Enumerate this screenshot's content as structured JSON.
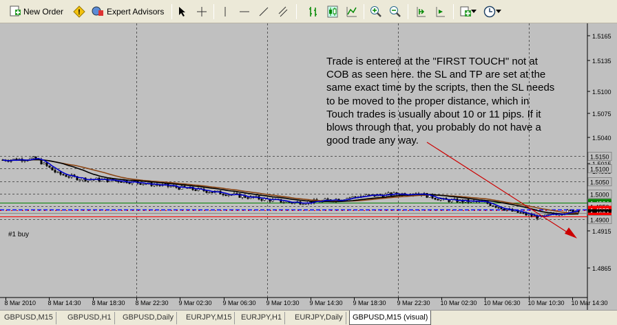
{
  "toolbar": {
    "new_order": "New Order",
    "expert_advisors": "Expert Advisors"
  },
  "chart": {
    "annotation": [
      "Trade is entered at the \"FIRST TOUCH\" not at",
      "COB as seen here.  the SL and TP are set at the",
      "same exact time by the scripts, then the SL needs",
      "to be moved to the proper distance, which in",
      "Touch trades is usually about 10 or 11 pips.  If it",
      "blows through that, you probably do not have a",
      "good trade any way."
    ],
    "order_label": "#1 buy",
    "colors": {
      "background": "#c0c0c0",
      "candle": "#000000",
      "ma_fast": "#0000cc",
      "ma_mid": "#000000",
      "ma_slow": "#8b4513",
      "tp_line": "#008000",
      "sl_line": "#ff0000",
      "entry_line": "#0000ff",
      "arrow": "#cc0000"
    },
    "price_scale": [
      "1.5165",
      "1.5135",
      "1.5100",
      "1.5075",
      "1.5040",
      "1.5015",
      "1.4985",
      "1.4950",
      "1.4915",
      "1.4865"
    ],
    "price_tags": [
      {
        "label": "1.5150",
        "price": 1.515,
        "kind": "grid"
      },
      {
        "label": "1.5100",
        "price": 1.51,
        "kind": "grid"
      },
      {
        "label": "1.5050",
        "price": 1.505,
        "kind": "grid"
      },
      {
        "label": "1.5000",
        "price": 1.5,
        "kind": "grid"
      },
      {
        "label": "1.4964",
        "price": 1.4964,
        "kind": "tp"
      },
      {
        "label": "1.4950",
        "price": 1.495,
        "kind": "grid"
      },
      {
        "label": "1.4938",
        "price": 1.4938,
        "kind": "entry"
      },
      {
        "label": "1.4924",
        "price": 1.4924,
        "kind": "bid"
      },
      {
        "label": "1.4910",
        "price": 1.491,
        "kind": "sl"
      },
      {
        "label": "1.4900",
        "price": 1.49,
        "kind": "grid"
      }
    ],
    "time_labels": [
      "8 Mar 2010",
      "8 Mar 14:30",
      "8 Mar 18:30",
      "8 Mar 22:30",
      "9 Mar 02:30",
      "9 Mar 06:30",
      "9 Mar 10:30",
      "9 Mar 14:30",
      "9 Mar 18:30",
      "9 Mar 22:30",
      "10 Mar 02:30",
      "10 Mar 06:30",
      "10 Mar 10:30",
      "10 Mar 14:30"
    ]
  },
  "tabs": [
    "GBPUSD,M15",
    "GBPUSD,H1",
    "GBPUSD,Daily",
    "EURJPY,M15",
    "EURJPY,H1",
    "EURJPY,Daily",
    "GBPUSD,M15 (visual)"
  ],
  "active_tab": "GBPUSD,M15 (visual)"
}
